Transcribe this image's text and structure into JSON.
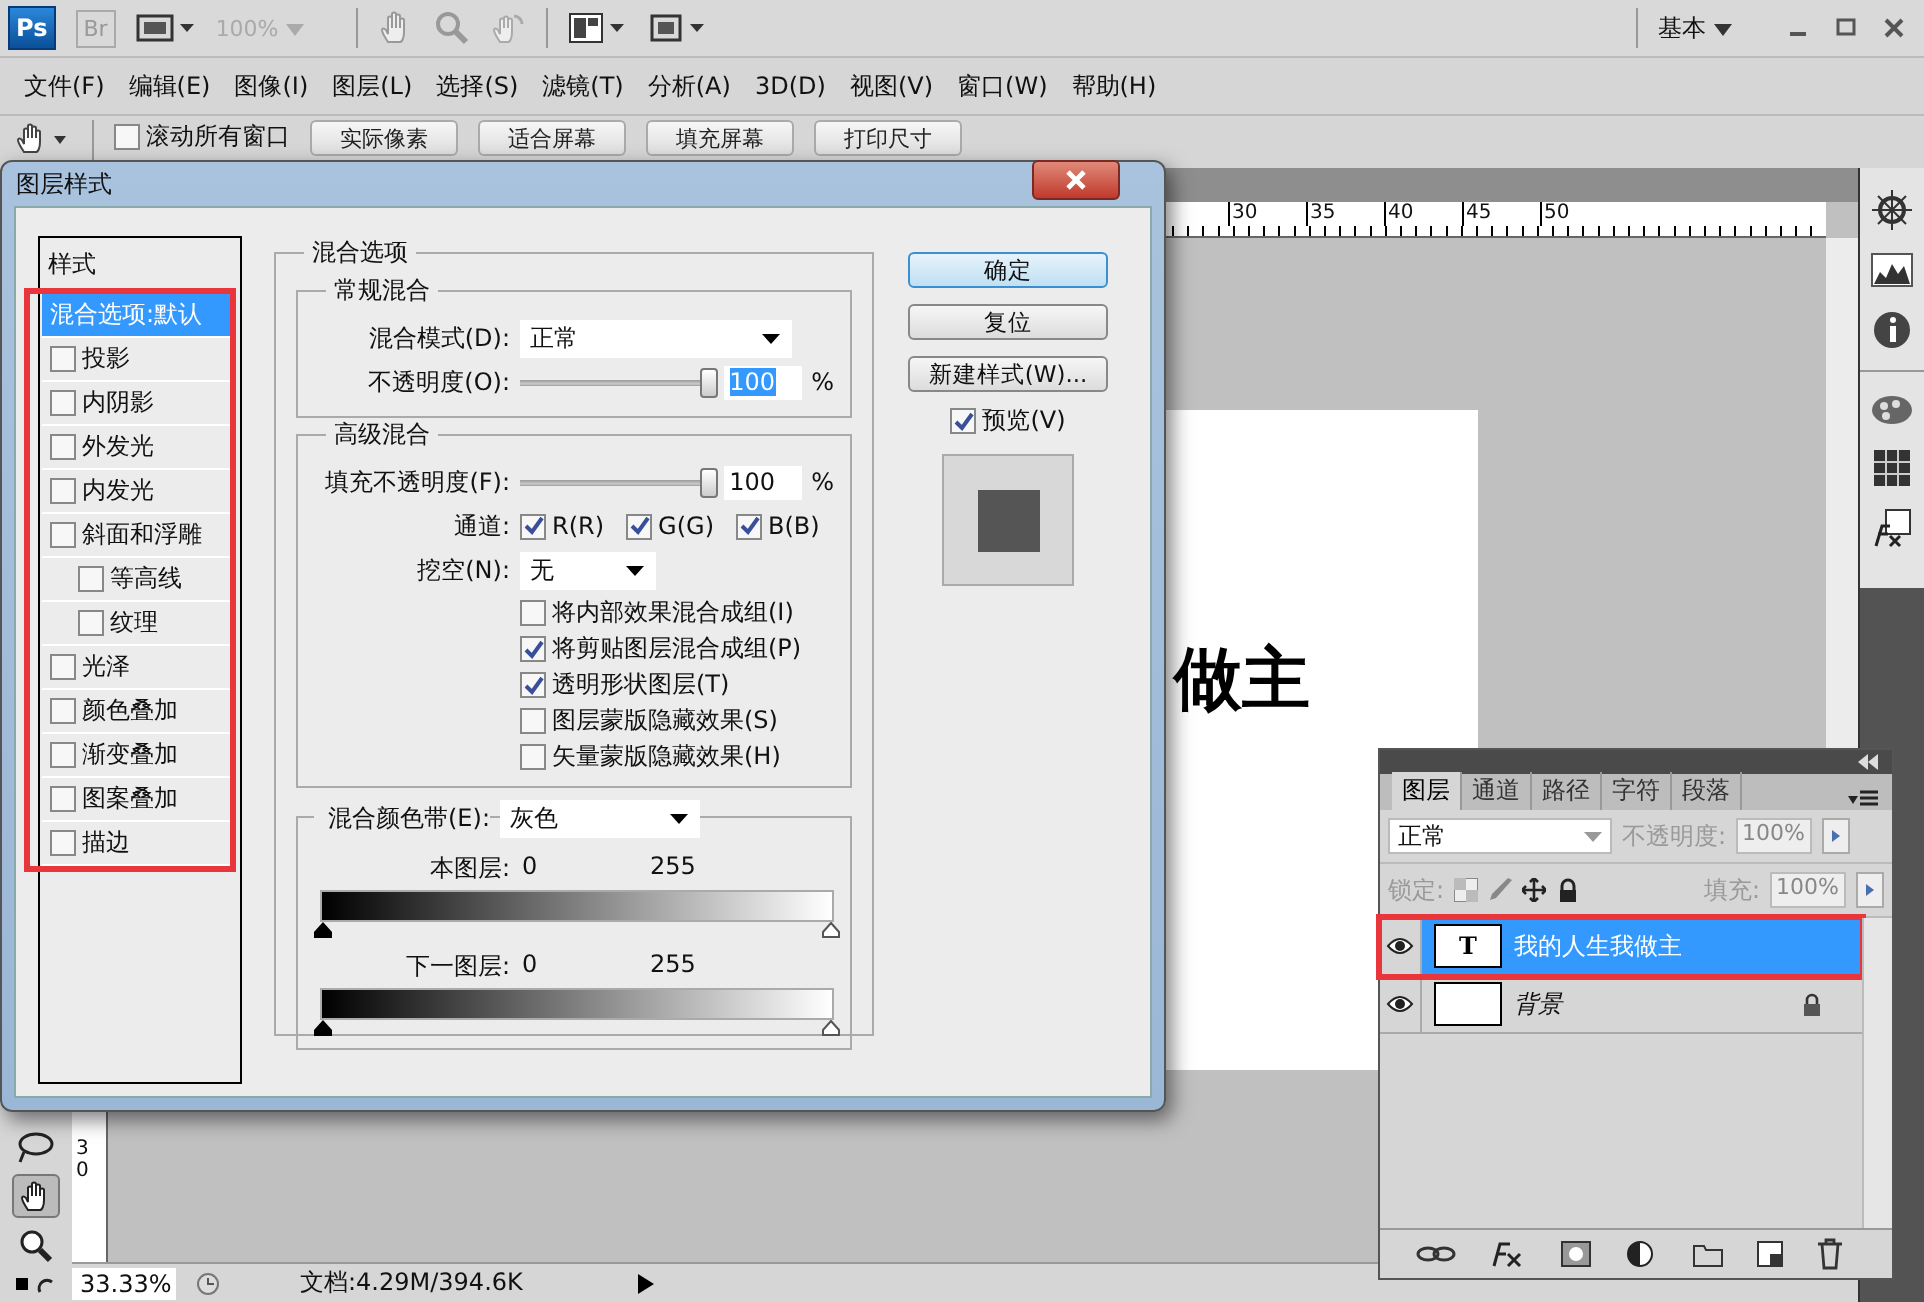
{
  "app_bar": {
    "logo": "Ps",
    "bridge": "Br",
    "zoom": "100%",
    "workspace": "基本"
  },
  "menu": [
    "文件(F)",
    "编辑(E)",
    "图像(I)",
    "图层(L)",
    "选择(S)",
    "滤镜(T)",
    "分析(A)",
    "3D(D)",
    "视图(V)",
    "窗口(W)",
    "帮助(H)"
  ],
  "options_bar": {
    "scroll_all": {
      "label": "滚动所有窗口",
      "checked": false
    },
    "buttons": [
      "实际像素",
      "适合屏幕",
      "填充屏幕",
      "打印尺寸"
    ]
  },
  "dialog": {
    "title": "图层样式",
    "styles_header": "样式",
    "styles_highlighted": true,
    "styles": [
      {
        "label": "混合选项:默认",
        "kind": "header",
        "selected": true
      },
      {
        "label": "投影",
        "kind": "check",
        "checked": false,
        "selected": false
      },
      {
        "label": "内阴影",
        "kind": "check",
        "checked": false,
        "selected": false
      },
      {
        "label": "外发光",
        "kind": "check",
        "checked": false,
        "selected": false
      },
      {
        "label": "内发光",
        "kind": "check",
        "checked": false,
        "selected": false
      },
      {
        "label": "斜面和浮雕",
        "kind": "check",
        "checked": false,
        "selected": false,
        "children": [
          {
            "label": "等高线",
            "kind": "check",
            "checked": false,
            "selected": false
          },
          {
            "label": "纹理",
            "kind": "check",
            "checked": false,
            "selected": false
          }
        ]
      },
      {
        "label": "光泽",
        "kind": "check",
        "checked": false,
        "selected": false
      },
      {
        "label": "颜色叠加",
        "kind": "check",
        "checked": false,
        "selected": false
      },
      {
        "label": "渐变叠加",
        "kind": "check",
        "checked": false,
        "selected": false
      },
      {
        "label": "图案叠加",
        "kind": "check",
        "checked": false,
        "selected": false
      },
      {
        "label": "描边",
        "kind": "check",
        "checked": false,
        "selected": false
      }
    ],
    "blend": {
      "title": "混合选项",
      "general": {
        "title": "常规混合",
        "mode_label": "混合模式(D):",
        "mode": "正常",
        "opacity_label": "不透明度(O):",
        "opacity_slider": {
          "level": 1
        },
        "opacity": "100",
        "unit": "%"
      },
      "advanced": {
        "title": "高级混合",
        "fill_label": "填充不透明度(F):",
        "fill_slider": {
          "level": 1
        },
        "fill": "100",
        "unit": "%",
        "channels_label": "通道:",
        "channels": [
          {
            "label": "R(R)",
            "checked": true
          },
          {
            "label": "G(G)",
            "checked": true
          },
          {
            "label": "B(B)",
            "checked": true
          }
        ],
        "knockout_label": "挖空(N):",
        "knockout": "无",
        "options": [
          {
            "label": "将内部效果混合成组(I)",
            "checked": false
          },
          {
            "label": "将剪贴图层混合成组(P)",
            "checked": true
          },
          {
            "label": "透明形状图层(T)",
            "checked": true
          },
          {
            "label": "图层蒙版隐藏效果(S)",
            "checked": false
          },
          {
            "label": "矢量蒙版隐藏效果(H)",
            "checked": false
          }
        ]
      },
      "blend_if": {
        "label": "混合颜色带(E):",
        "value": "灰色",
        "bands": [
          {
            "label": "本图层:",
            "low": "0",
            "high": "255"
          },
          {
            "label": "下一图层:",
            "low": "0",
            "high": "255"
          }
        ]
      }
    },
    "buttons": [
      {
        "label": "确定",
        "default": true
      },
      {
        "label": "复位",
        "default": false
      },
      {
        "label": "新建样式(W)...",
        "default": false
      }
    ],
    "preview": {
      "label": "预览(V)",
      "checked": true
    }
  },
  "ruler": [
    "30",
    "35",
    "40",
    "45",
    "50"
  ],
  "side_ruler": "30",
  "canvas_text": "做主",
  "layers_panel": {
    "tabs": [
      {
        "label": "图层",
        "selected": true
      },
      {
        "label": "通道",
        "selected": false
      },
      {
        "label": "路径",
        "selected": false
      },
      {
        "label": "字符",
        "selected": false
      },
      {
        "label": "段落",
        "selected": false
      }
    ],
    "blend_mode": "正常",
    "opacity_label": "不透明度:",
    "opacity": "100%",
    "lock_label": "锁定:",
    "fill_label": "填充:",
    "fill": "100%",
    "layers": [
      {
        "name": "我的人生我做主",
        "kind": "text",
        "thumb": "T",
        "selected": true,
        "visible": true,
        "locked": false,
        "highlighted": true
      },
      {
        "name": "背景",
        "kind": "background",
        "selected": false,
        "visible": true,
        "locked": true,
        "highlighted": false
      }
    ]
  },
  "status_bar": {
    "zoom": "33.33%",
    "doc": "文档:4.29M/394.6K"
  }
}
